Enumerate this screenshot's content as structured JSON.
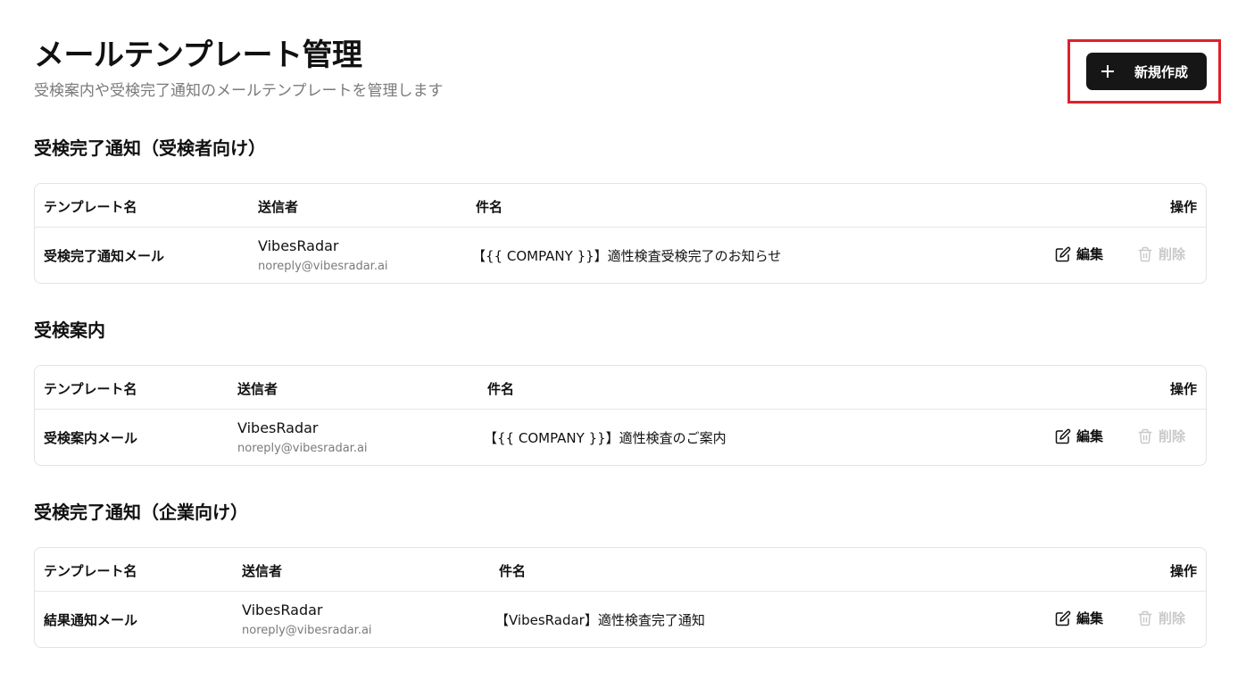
{
  "header": {
    "title": "メールテンプレート管理",
    "subtitle": "受検案内や受検完了通知のメールテンプレートを管理します",
    "new_button_label": "新規作成"
  },
  "table_columns": {
    "name": "テンプレート名",
    "sender": "送信者",
    "subject": "件名",
    "actions": "操作"
  },
  "row_actions": {
    "edit_label": "編集",
    "delete_label": "削除"
  },
  "sections": [
    {
      "title": "受検完了通知（受検者向け）",
      "rows": [
        {
          "name": "受検完了通知メール",
          "sender_name": "VibesRadar",
          "sender_email": "noreply@vibesradar.ai",
          "subject": "【{{ COMPANY }}】適性検査受検完了のお知らせ"
        }
      ]
    },
    {
      "title": "受検案内",
      "rows": [
        {
          "name": "受検案内メール",
          "sender_name": "VibesRadar",
          "sender_email": "noreply@vibesradar.ai",
          "subject": "【{{ COMPANY }}】適性検査のご案内"
        }
      ]
    },
    {
      "title": "受検完了通知（企業向け）",
      "rows": [
        {
          "name": "結果通知メール",
          "sender_name": "VibesRadar",
          "sender_email": "noreply@vibesradar.ai",
          "subject": "【VibesRadar】適性検査完了通知"
        }
      ]
    }
  ]
}
